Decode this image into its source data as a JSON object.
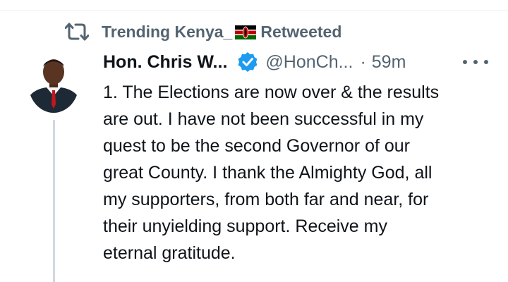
{
  "social_context": {
    "account": "Trending Kenya_",
    "action": "Retweeted",
    "flag_colors": {
      "black": "#000000",
      "red": "#bb0000",
      "green": "#006600",
      "white": "#ffffff"
    }
  },
  "tweet": {
    "display_name": "Hon. Chris W...",
    "handle": "@HonCh...",
    "separator": "·",
    "time": "59m",
    "verified_color": "#1d9bf0",
    "text": "1. The Elections are now over & the results\nare out. I have not been successful in my\nquest to be the second Governor of our\ngreat County. I thank the Almighty God, all\nmy supporters, from both far and near, for\ntheir unyielding support. Receive my\neternal gratitude."
  }
}
